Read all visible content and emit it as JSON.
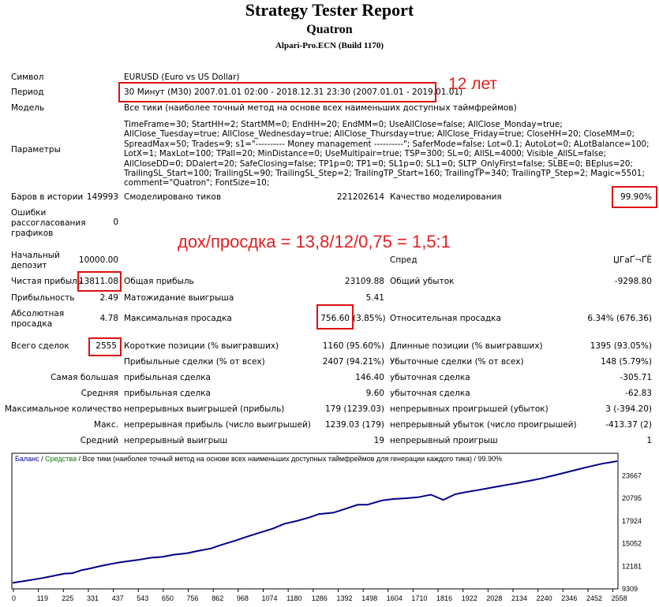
{
  "header": {
    "title": "Strategy Tester Report",
    "ea_name": "Quatron",
    "server": "Alpari-Pro.ECN (Build 1170)"
  },
  "info": {
    "symbol_label": "Символ",
    "symbol_value": "EURUSD (Euro vs US Dollar)",
    "period_label": "Период",
    "period_value": "30 Минут (M30) 2007.01.01 02:00 - 2018.12.31 23:30 (2007.01.01 - 2019.01.01)",
    "model_label": "Модель",
    "model_value": "Все тики (наиболее точный метод на основе всех наименьших доступных таймфреймов)",
    "params_label": "Параметры",
    "params_value": "TimeFrame=30; StartHH=2; StartMM=0; EndHH=20; EndMM=0; UseAllClose=false; AllClose_Monday=true; AllClose_Tuesday=true; AllClose_Wednesday=true; AllClose_Thursday=true; AllClose_Friday=true; CloseHH=20; CloseMM=0; SpreadMax=50; Trades=9; s1=\"---------- Money management ----------\"; SaferMode=false; Lot=0.1; AutoLot=0; ALotBalance=100; LotX=1; MaxLot=100; TPall=20; MinDistance=0; UseMultipair=true; TSP=300; SL=0; AllSL=4000; Visible_AllSL=false; AllCloseDD=0; DDalert=20; SafeClosing=false; TP1p=0; TP1=0; SL1p=0; SL1=0; SLTP_OnlyFirst=false; SLBE=0; BEplus=20; TrailingSL_Start=100; TrailingSL=90; TrailingSL_Step=2; TrailingTP_Start=160; TrailingTP=340; TrailingTP_Step=2; Magic=5501; comment=\"Quatron\"; FontSize=10;"
  },
  "annotations": {
    "years": "12 лет",
    "ratio": "дох/просдка = 13,8/12/0,75 =  1,5:1"
  },
  "stats": {
    "bars_label": "Баров в истории",
    "bars_value": "149993",
    "ticks_label": "Смоделировано тиков",
    "ticks_value": "221202614",
    "quality_label": "Качество моделирования",
    "quality_value": "99.90%",
    "errors_label_1": "Ошибки",
    "errors_label_2": "рассогласования",
    "errors_label_3": "графиков",
    "errors_value": "0",
    "deposit_label_1": "Начальный",
    "deposit_label_2": "депозит",
    "deposit_value": "10000.00",
    "spread_label": "Спред",
    "spread_value": "ЏГаҐ¬ҐЁ",
    "net_profit_label": "Чистая прибыль",
    "net_profit_value": "13811.08",
    "gross_profit_label": "Общая прибыль",
    "gross_profit_value": "23109.88",
    "gross_loss_label": "Общий убыток",
    "gross_loss_value": "-9298.80",
    "profit_factor_label": "Прибыльность",
    "profit_factor_value": "2.49",
    "expected_payoff_label": "Матожидание выигрыша",
    "expected_payoff_value": "5.41",
    "abs_dd_label_1": "Абсолютная",
    "abs_dd_label_2": "просадка",
    "abs_dd_value": "4.78",
    "max_dd_label": "Максимальная просадка",
    "max_dd_value": "756.60",
    "max_dd_pct": "(3.85%)",
    "rel_dd_label": "Относительная просадка",
    "rel_dd_value": "6.34% (676.36)",
    "total_trades_label": "Всего сделок",
    "total_trades_value": "2555",
    "short_label": "Короткие позиции (% выигравших)",
    "short_value": "1160 (95.60%)",
    "long_label": "Длинные позиции (% выигравших)",
    "long_value": "1395 (93.05%)",
    "profit_trades_label": "Прибыльные сделки (% от всех)",
    "profit_trades_value": "2407 (94.21%)",
    "loss_trades_label": "Убыточные сделки (% от всех)",
    "loss_trades_value": "148 (5.79%)",
    "largest_label": "Самая большая",
    "largest_profit_label": "прибыльная сделка",
    "largest_profit_value": "146.40",
    "largest_loss_label": "убыточная сделка",
    "largest_loss_value": "-305.71",
    "average_label": "Средняя",
    "average_profit_label": "прибыльная сделка",
    "average_profit_value": "9.60",
    "average_loss_label": "убыточная сделка",
    "average_loss_value": "-62.83",
    "max_count_label": "Максимальное количество",
    "max_cons_wins_label": "непрерывных выигрышей (прибыль)",
    "max_cons_wins_value": "179 (1239.03)",
    "max_cons_losses_label": "непрерывных проигрышей (убыток)",
    "max_cons_losses_value": "3 (-394.20)",
    "max_label": "Макс.",
    "max_cons_profit_label": "непрерывная прибыль (число выигрышей)",
    "max_cons_profit_value": "1239.03 (179)",
    "max_cons_loss_label": "непрерывный убыток (число проигрышей)",
    "max_cons_loss_value": "-413.37 (2)",
    "avg_label": "Средний",
    "avg_cons_wins_label": "непрерывный выигрыш",
    "avg_cons_wins_value": "19",
    "avg_cons_losses_label": "непрерывный проигрыш",
    "avg_cons_losses_value": "1"
  },
  "chart_data": {
    "type": "line",
    "legend_balance": "Баланс",
    "legend_sep": " / ",
    "legend_equity": "Средства",
    "legend_rest": " / Все тики (наиболее точный метод на основе всех наименьших доступных таймфреймов для генерации каждого тика) / 99.90%",
    "x_ticks": [
      "0",
      "119",
      "225",
      "331",
      "437",
      "543",
      "650",
      "756",
      "862",
      "968",
      "1074",
      "1180",
      "1286",
      "1392",
      "1498",
      "1604",
      "1710",
      "1816",
      "1922",
      "2028",
      "2134",
      "2240",
      "2346",
      "2452",
      "2558"
    ],
    "y_ticks": [
      "23667",
      "20795",
      "17924",
      "15052",
      "12181",
      "9309"
    ],
    "xlim": [
      0,
      2625
    ],
    "ylim": [
      9309,
      24500
    ],
    "line_color": "#00008b",
    "x": [
      0,
      60,
      119,
      180,
      225,
      260,
      300,
      331,
      380,
      437,
      470,
      543,
      600,
      650,
      700,
      756,
      800,
      862,
      900,
      968,
      1020,
      1074,
      1130,
      1180,
      1230,
      1286,
      1330,
      1392,
      1440,
      1498,
      1540,
      1604,
      1650,
      1710,
      1760,
      1816,
      1870,
      1922,
      1970,
      2028,
      2080,
      2134,
      2190,
      2240,
      2290,
      2346,
      2400,
      2452,
      2500,
      2558,
      2625
    ],
    "y": [
      9900,
      10150,
      10400,
      10700,
      10950,
      11000,
      11350,
      11500,
      11800,
      12100,
      12250,
      12500,
      12750,
      12850,
      13100,
      13250,
      13500,
      13800,
      14150,
      14700,
      15150,
      15600,
      16050,
      16600,
      16900,
      17300,
      17700,
      17850,
      18250,
      18750,
      18750,
      19250,
      19400,
      19500,
      19600,
      19900,
      19300,
      19950,
      20200,
      20450,
      20700,
      20950,
      21200,
      21450,
      21700,
      22050,
      22400,
      22750,
      23050,
      23400,
      23700
    ]
  }
}
